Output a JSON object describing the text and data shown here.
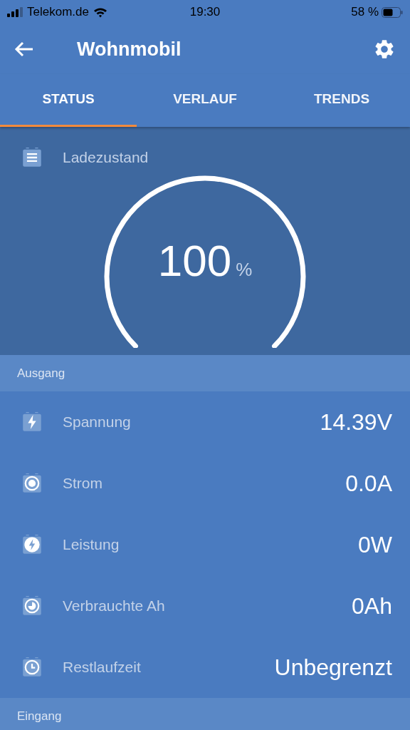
{
  "status_bar": {
    "carrier": "Telekom.de",
    "time": "19:30",
    "battery": "58 %"
  },
  "app_bar": {
    "title": "Wohnmobil"
  },
  "tabs": [
    {
      "label": "STATUS",
      "selected": true
    },
    {
      "label": "VERLAUF",
      "selected": false
    },
    {
      "label": "TRENDS",
      "selected": false
    }
  ],
  "gauge": {
    "label": "Ladezustand",
    "value": "100",
    "unit": "%"
  },
  "sections": [
    {
      "title": "Ausgang",
      "rows": [
        {
          "kind": "voltage",
          "label": "Spannung",
          "value": "14.39V"
        },
        {
          "kind": "current",
          "label": "Strom",
          "value": "0.0A"
        },
        {
          "kind": "power",
          "label": "Leistung",
          "value": "0W"
        },
        {
          "kind": "consumed",
          "label": "Verbrauchte Ah",
          "value": "0Ah"
        },
        {
          "kind": "time",
          "label": "Restlaufzeit",
          "value": "Unbegrenzt"
        }
      ]
    },
    {
      "title": "Eingang"
    }
  ]
}
